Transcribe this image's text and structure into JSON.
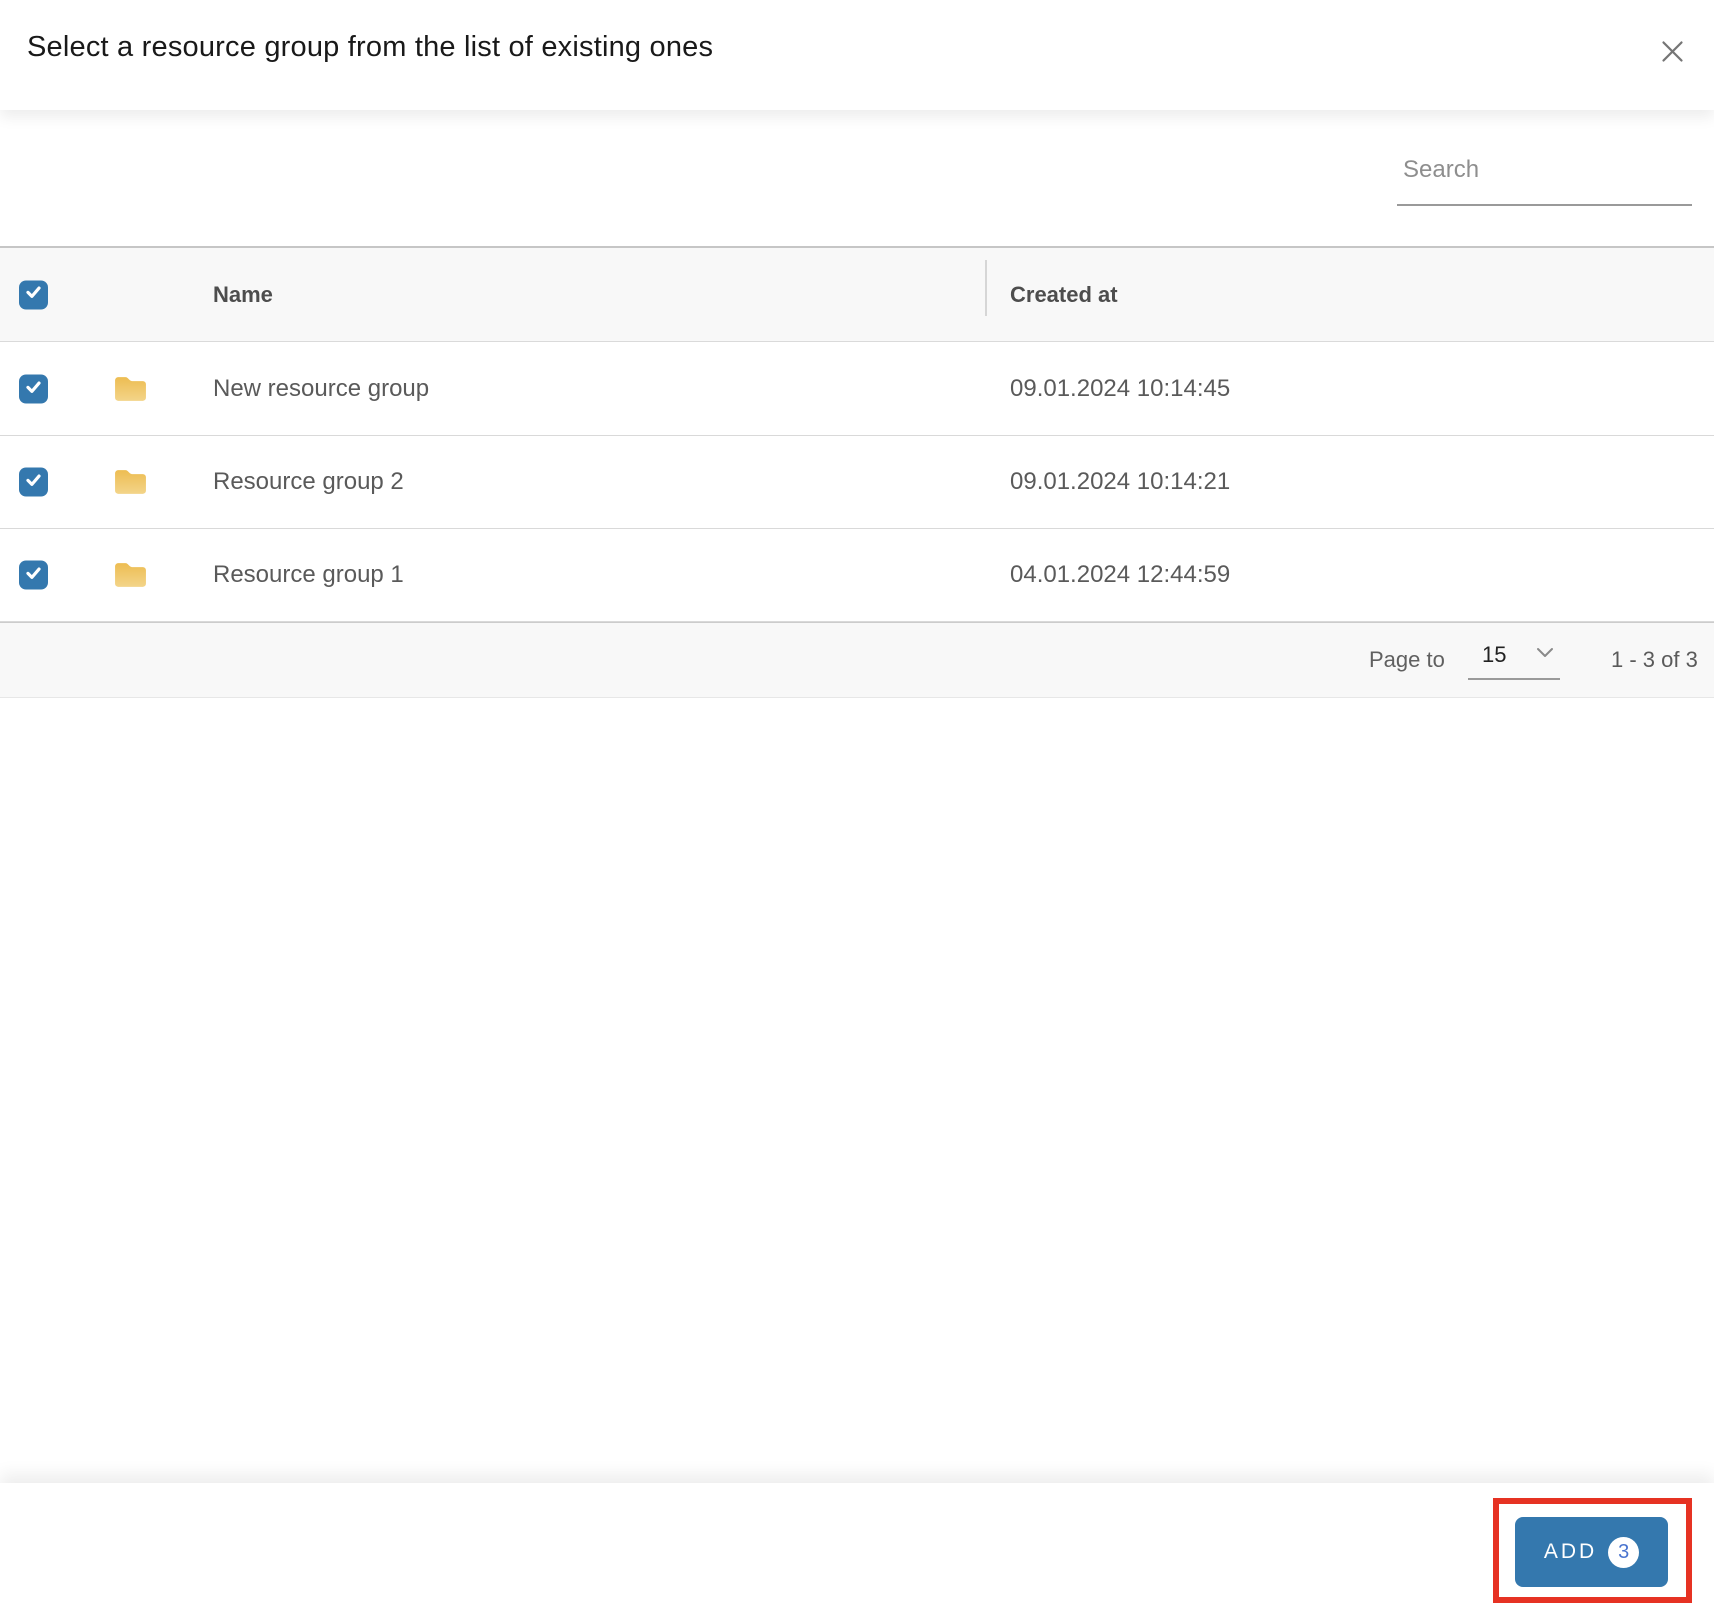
{
  "dialog": {
    "title": "Select a resource group from the list of existing ones"
  },
  "toolbar": {
    "search_placeholder": "Search"
  },
  "table": {
    "header": {
      "name": "Name",
      "created_at": "Created at"
    },
    "rows": [
      {
        "name": "New resource group",
        "created_at": "09.01.2024 10:14:45",
        "checked": true
      },
      {
        "name": "Resource group 2",
        "created_at": "09.01.2024 10:14:21",
        "checked": true
      },
      {
        "name": "Resource group 1",
        "created_at": "04.01.2024 12:44:59",
        "checked": true
      }
    ]
  },
  "pagination": {
    "label": "Page to",
    "page_size": "15",
    "range": "1 - 3 of 3"
  },
  "actions": {
    "add_label": "ADD",
    "add_badge": "3"
  },
  "colors": {
    "accent_blue": "#3478ae",
    "badge_number_blue": "#4a74cf",
    "folder_yellow_top": "#edbd52",
    "folder_yellow_bottom": "#f3d489",
    "annotation_red": "#e63223",
    "header_row_bg": "#f8f8f8"
  }
}
